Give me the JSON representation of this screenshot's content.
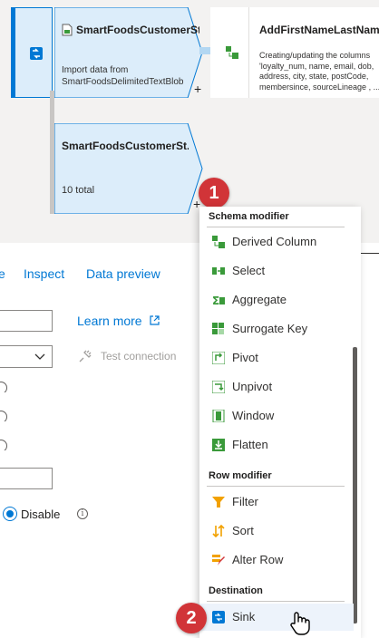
{
  "canvas": {
    "source_node": {
      "title": "SmartFoodsCustomerSt...",
      "desc_line1": "Import data from",
      "desc_line2": "SmartFoodsDelimitedTextBlob",
      "plus": "+"
    },
    "derived_node": {
      "title": "AddFirstNameLastName",
      "desc": "Creating/updating the columns 'loyalty_num, name, email, dob, address, city, state, postCode, membersince, sourceLineage , ..."
    },
    "second_node": {
      "title": "SmartFoodsCustomerSt...",
      "count": "10 total",
      "plus": "+"
    }
  },
  "callouts": {
    "one": "1",
    "two": "2"
  },
  "panel": {
    "tabs": [
      "e",
      "Inspect",
      "Data preview"
    ],
    "learn_more": "Learn more",
    "test_connection": "Test connection",
    "disable_label": "Disable",
    "info_glyph": "i"
  },
  "menu": {
    "sections": [
      {
        "title": "Schema modifier",
        "items": [
          {
            "label": "Derived Column",
            "icon": "derived-column-icon"
          },
          {
            "label": "Select",
            "icon": "select-icon"
          },
          {
            "label": "Aggregate",
            "icon": "aggregate-icon"
          },
          {
            "label": "Surrogate Key",
            "icon": "surrogate-key-icon"
          },
          {
            "label": "Pivot",
            "icon": "pivot-icon"
          },
          {
            "label": "Unpivot",
            "icon": "unpivot-icon"
          },
          {
            "label": "Window",
            "icon": "window-icon"
          },
          {
            "label": "Flatten",
            "icon": "flatten-icon"
          }
        ]
      },
      {
        "title": "Row modifier",
        "items": [
          {
            "label": "Filter",
            "icon": "filter-icon"
          },
          {
            "label": "Sort",
            "icon": "sort-icon"
          },
          {
            "label": "Alter Row",
            "icon": "alter-row-icon"
          }
        ]
      },
      {
        "title": "Destination",
        "items": [
          {
            "label": "Sink",
            "icon": "sink-icon"
          }
        ]
      }
    ]
  },
  "colors": {
    "accent": "#0078d4",
    "badge": "#d13438",
    "green": "#3a9a3a"
  }
}
